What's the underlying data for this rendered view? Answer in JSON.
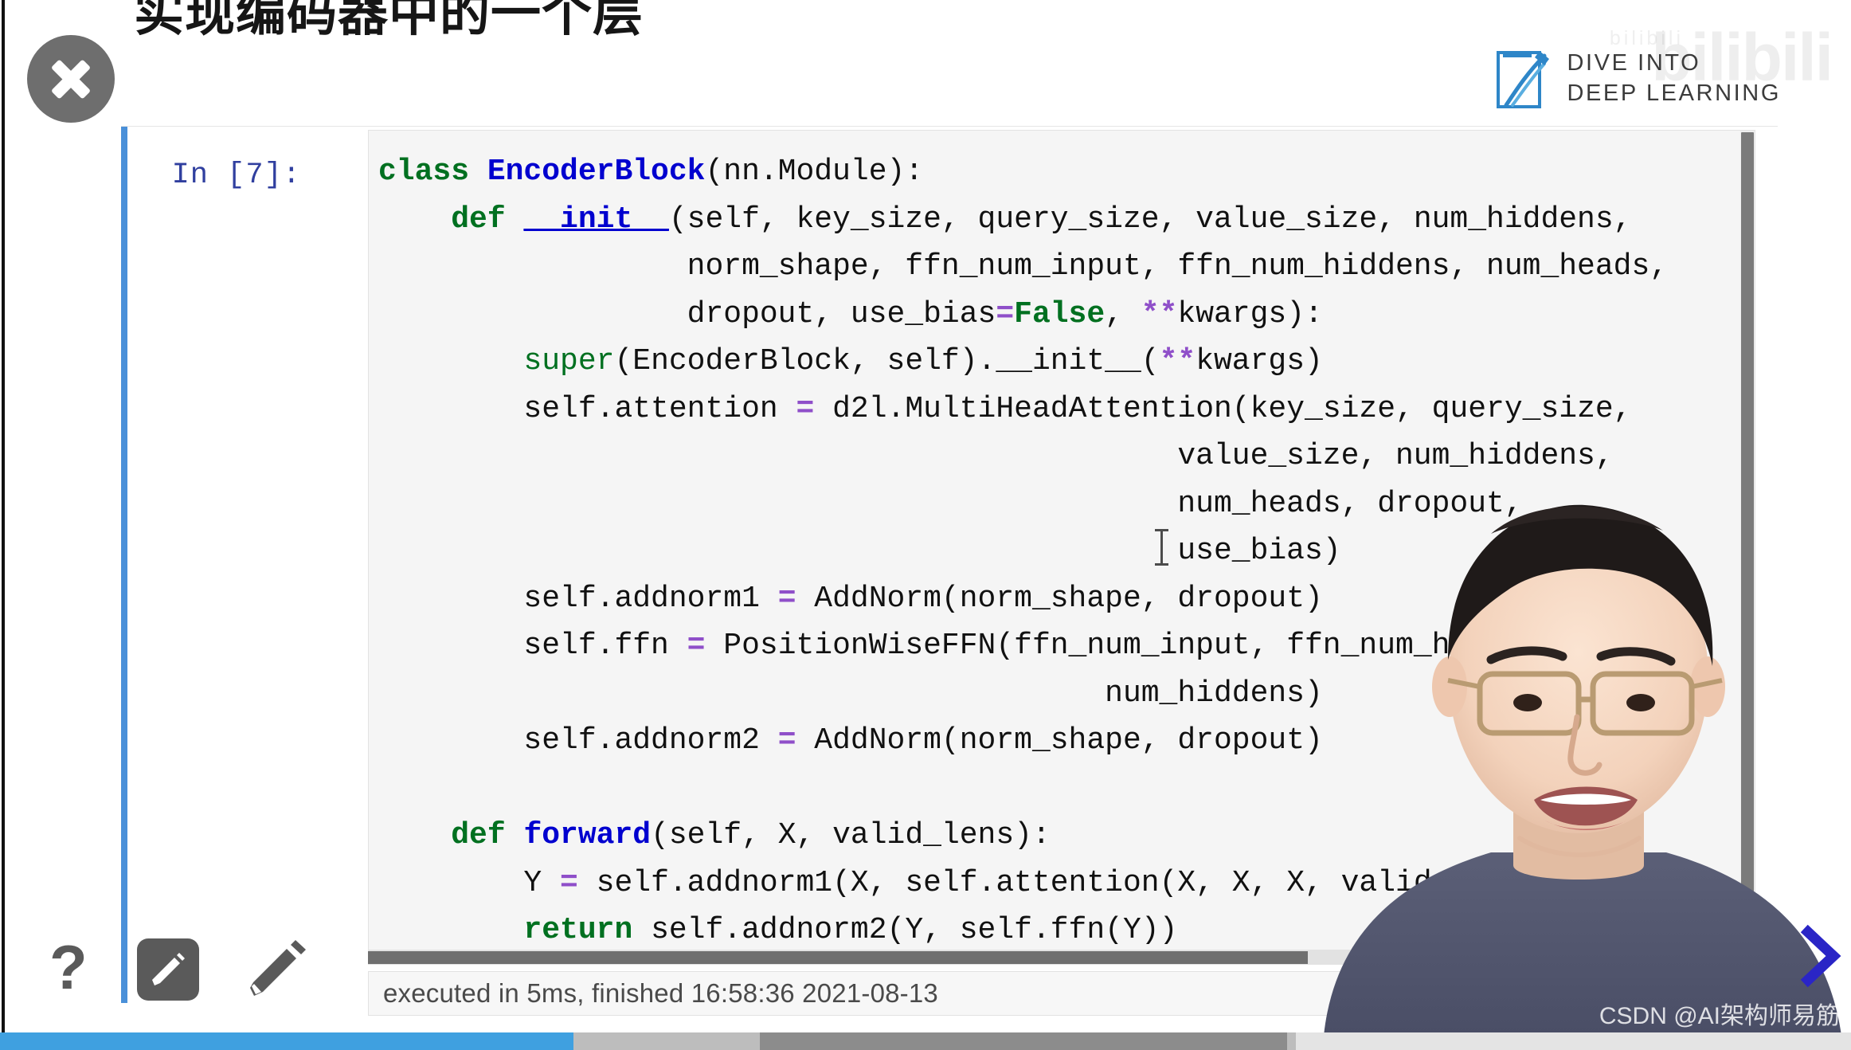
{
  "slide": {
    "title": "实现编码器中的一个层"
  },
  "brand": {
    "line1": "DIVE INTO",
    "line2": "DEEP LEARNING",
    "mark_icon": "book-pen-logo-icon"
  },
  "watermarks": {
    "bilibili": "bilibili",
    "bilibili_sub": "bilibili",
    "csdn": "CSDN @AI架构师易筋"
  },
  "controls": {
    "close_icon": "close-circle-icon",
    "next_icon": "chevron-right-icon",
    "help_icon": "question-mark-icon",
    "edit_icon": "pencil-icon",
    "edit_icon_alt": "pencil-icon"
  },
  "notebook": {
    "prompt": "In [7]:",
    "cell_type": "code",
    "selected": true,
    "code_lines": [
      [
        {
          "t": "class ",
          "c": "kw"
        },
        {
          "t": "EncoderBlock",
          "c": "fn"
        },
        {
          "t": "(nn.Module):",
          "c": "plain"
        }
      ],
      [
        {
          "t": "    def ",
          "c": "kw"
        },
        {
          "t": "__init__",
          "c": "dund"
        },
        {
          "t": "(self, key_size, query_size, value_size, num_hiddens,",
          "c": "plain"
        }
      ],
      [
        {
          "t": "                 norm_shape, ffn_num_input, ffn_num_hiddens, num_heads,",
          "c": "plain"
        }
      ],
      [
        {
          "t": "                 dropout, use_bias",
          "c": "plain"
        },
        {
          "t": "=",
          "c": "op"
        },
        {
          "t": "False",
          "c": "const"
        },
        {
          "t": ", ",
          "c": "plain"
        },
        {
          "t": "**",
          "c": "op"
        },
        {
          "t": "kwargs):",
          "c": "plain"
        }
      ],
      [
        {
          "t": "        ",
          "c": "plain"
        },
        {
          "t": "super",
          "c": "bi"
        },
        {
          "t": "(EncoderBlock, self).__init__(",
          "c": "plain"
        },
        {
          "t": "**",
          "c": "op"
        },
        {
          "t": "kwargs)",
          "c": "plain"
        }
      ],
      [
        {
          "t": "        self.attention ",
          "c": "plain"
        },
        {
          "t": "=",
          "c": "op"
        },
        {
          "t": " d2l.MultiHeadAttention(key_size, query_size,",
          "c": "plain"
        }
      ],
      [
        {
          "t": "                                            value_size, num_hiddens,",
          "c": "plain"
        }
      ],
      [
        {
          "t": "                                            num_heads, dropout,",
          "c": "plain"
        }
      ],
      [
        {
          "t": "                                            use_bias)",
          "c": "plain"
        }
      ],
      [
        {
          "t": "        self.addnorm1 ",
          "c": "plain"
        },
        {
          "t": "=",
          "c": "op"
        },
        {
          "t": " AddNorm(norm_shape, dropout)",
          "c": "plain"
        }
      ],
      [
        {
          "t": "        self.ffn ",
          "c": "plain"
        },
        {
          "t": "=",
          "c": "op"
        },
        {
          "t": " PositionWiseFFN(ffn_num_input, ffn_num_hiddens,",
          "c": "plain"
        }
      ],
      [
        {
          "t": "                                        num_hiddens)",
          "c": "plain"
        }
      ],
      [
        {
          "t": "        self.addnorm2 ",
          "c": "plain"
        },
        {
          "t": "=",
          "c": "op"
        },
        {
          "t": " AddNorm(norm_shape, dropout)",
          "c": "plain"
        }
      ],
      [
        {
          "t": "",
          "c": "plain"
        }
      ],
      [
        {
          "t": "    def ",
          "c": "kw"
        },
        {
          "t": "forward",
          "c": "fn"
        },
        {
          "t": "(self, X, valid_lens):",
          "c": "plain"
        }
      ],
      [
        {
          "t": "        Y ",
          "c": "plain"
        },
        {
          "t": "=",
          "c": "op"
        },
        {
          "t": " self.addnorm1(X, self.attention(X, X, X, valid_lens))",
          "c": "plain"
        }
      ],
      [
        {
          "t": "        ",
          "c": "plain"
        },
        {
          "t": "return",
          "c": "kw"
        },
        {
          "t": " self.addnorm2(Y, self.ffn(Y))",
          "c": "plain"
        }
      ]
    ],
    "exec_status": "executed in 5ms, finished 16:58:36 2021-08-13"
  },
  "player": {
    "played_percent": 31,
    "buffered_percent": 70
  },
  "colors": {
    "accent_blue": "#4a90d9",
    "progress_played": "#3fa0e0",
    "keyword_green": "#007020",
    "function_blue": "#0000cf",
    "operator_purple": "#8f4fc9",
    "code_bg": "#f5f5f5",
    "prompt_navy": "#303f9f"
  }
}
